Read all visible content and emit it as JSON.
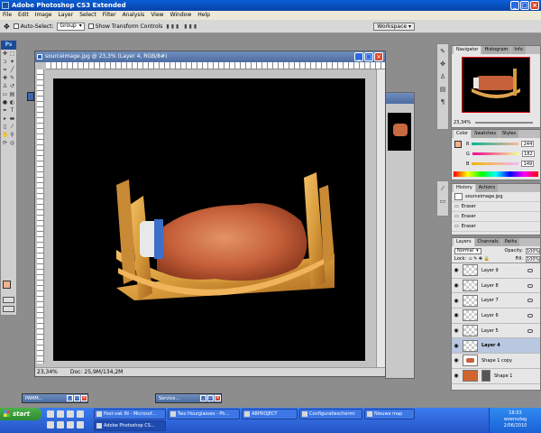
{
  "app": {
    "title": "Adobe Photoshop CS3 Extended",
    "accent": "#0842a8"
  },
  "menu": [
    "File",
    "Edit",
    "Image",
    "Layer",
    "Select",
    "Filter",
    "Analysis",
    "View",
    "Window",
    "Help"
  ],
  "options": {
    "auto_select_label": "Auto-Select:",
    "auto_select_value": "Group",
    "transform_label": "Show Transform Controls",
    "workspace_label": "Workspace"
  },
  "document": {
    "title": "sourceimage.jpg @ 23,3% (Layer 4, RGB/8#)",
    "zoom": "23,34%",
    "doc_size": "Doc: 25,9M/134,2M"
  },
  "navigator": {
    "tabs": [
      "Navigator",
      "Histogram",
      "Info"
    ],
    "zoom": "23,34%"
  },
  "color_panel": {
    "tabs": [
      "Color",
      "Swatches",
      "Styles"
    ],
    "channels": [
      {
        "label": "R",
        "value": "244"
      },
      {
        "label": "G",
        "value": "182"
      },
      {
        "label": "B",
        "value": "149"
      }
    ],
    "foreground": "#f0b28f"
  },
  "history": {
    "tabs": [
      "History",
      "Actions"
    ],
    "items": [
      "sourceimage.jpg",
      "Eraser",
      "Eraser",
      "Eraser"
    ]
  },
  "layers": {
    "tabs": [
      "Layers",
      "Channels",
      "Paths"
    ],
    "blend_mode": "Normal",
    "opacity_label": "Opacity:",
    "opacity": "100%",
    "lock_label": "Lock:",
    "fill_label": "Fill:",
    "fill": "100%",
    "items": [
      {
        "name": "Layer 9",
        "active": false
      },
      {
        "name": "Layer 8",
        "active": false
      },
      {
        "name": "Layer 7",
        "active": false
      },
      {
        "name": "Layer 6",
        "active": false
      },
      {
        "name": "Layer 5",
        "active": false
      },
      {
        "name": "Layer 4",
        "active": true
      },
      {
        "name": "Shape 1 copy",
        "active": false
      },
      {
        "name": "Shape 1",
        "active": false
      }
    ]
  },
  "minimized": [
    "PAMM...",
    "Service..."
  ],
  "taskbar": {
    "start": "start",
    "buttons": [
      "Post-vak IN - Microsof...",
      "Two Hourglasses - Ph...",
      "ABPROJECT",
      "Configuratieschermi",
      "Nieuwe map",
      "Adobe Photoshop CS..."
    ],
    "time": "16:53",
    "day": "woensdag",
    "date": "2/06/2010"
  }
}
